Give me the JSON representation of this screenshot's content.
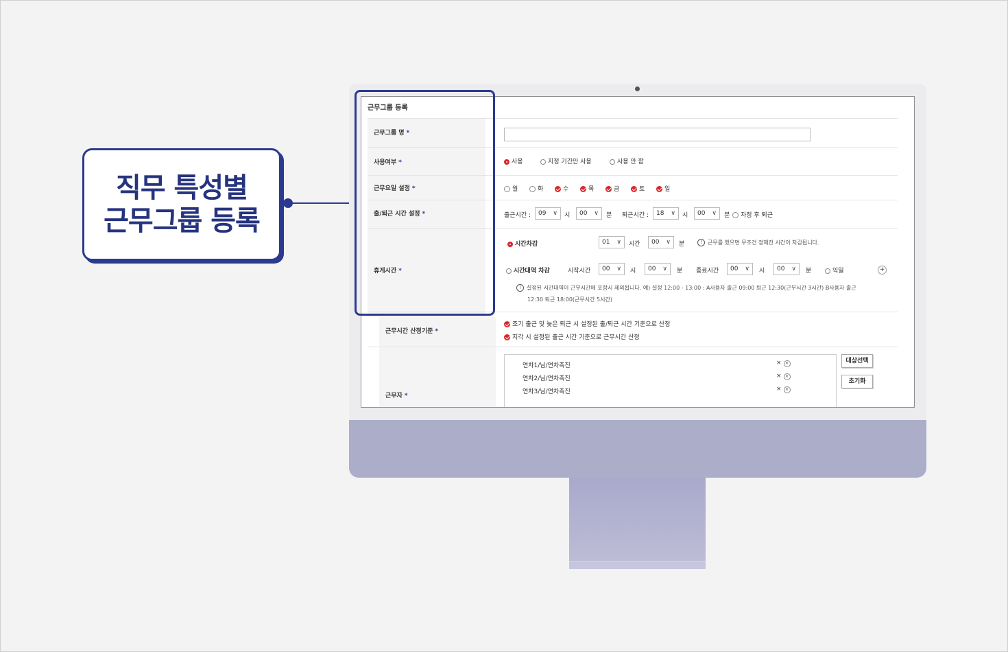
{
  "callout": {
    "line1": "직무 특성별",
    "line2": "근무그룹 등록"
  },
  "form": {
    "title": "근무그룹 등록",
    "labels": {
      "group_name": "근무그룹 명",
      "use": "사용여부",
      "workdays": "근무요일 설정",
      "commute": "출/퇴근 시간 설정",
      "break": "휴게시간",
      "calc": "근무시간 산정기준",
      "workers": "근무자"
    },
    "required_mark": "*",
    "use_options": [
      "사용",
      "지정 기간만 사용",
      "사용 안 함"
    ],
    "days": [
      "월",
      "화",
      "수",
      "목",
      "금",
      "토",
      "일"
    ],
    "commute": {
      "in_label": "출근시간 :",
      "in_hour": "09",
      "hour_unit": "시",
      "in_min": "00",
      "min_unit": "분",
      "out_label": "퇴근시간 :",
      "out_hour": "18",
      "out_min": "00",
      "auto_label": "자정 후 퇴근"
    },
    "break": {
      "deduct_label": "시간차감",
      "deduct_hour": "01",
      "time_unit": "시간",
      "deduct_min": "00",
      "min_unit": "분",
      "deduct_note": "근무를 했으면 무조건 정해진 시간이 차감됩니다.",
      "range_label": "시간대역 차감",
      "start_label": "시작시간",
      "start_hour": "00",
      "hour_unit": "시",
      "start_min": "00",
      "end_label": "종료시간",
      "end_hour": "00",
      "end_min": "00",
      "next_day": "익일",
      "plus": "+",
      "range_note1": "설정된 시간대역이 근무시간에 포함시 제외됩니다. 예) 설정 12:00 - 13:00 : A사용자 출근 09:00 퇴근 12:30(근무시간 3시간) B사용자 출근",
      "range_note2": "12:30 퇴근 18:00(근무시간 5시간)"
    },
    "calc_options": [
      "조기 출근 및 늦은 퇴근 시 설정된 출/퇴근 시간 기준으로 산정",
      "지각 시 설정된 출근 시간 기준으로 근무시간 산정"
    ],
    "workers": [
      "연차1/님/연차촉진",
      "연차2/님/연차촉진",
      "연차3/님/연차촉진"
    ],
    "remove_mark": "×",
    "buttons": {
      "select": "대상선택",
      "reset": "초기화"
    }
  },
  "colors": {
    "accent": "#2b3a8f",
    "check": "#d9262c",
    "chin": "#abadc9"
  }
}
